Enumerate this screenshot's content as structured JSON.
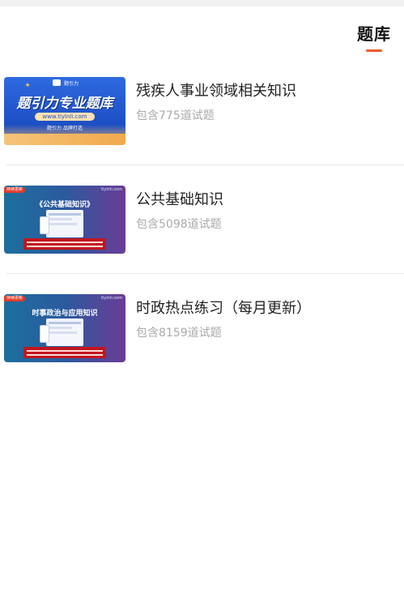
{
  "header": {
    "tab_label": "题库"
  },
  "items": [
    {
      "title": "残疾人事业领域相关知识",
      "subtitle": "包含775道试题",
      "thumb": {
        "headline": "题引力专业题库",
        "url": "www.tiylnli.com",
        "footer": "题引力 品牌打造",
        "logo_text": "题引力"
      }
    },
    {
      "title": "公共基础知识",
      "subtitle": "包含5098道试题",
      "thumb": {
        "tag": "持续更新",
        "site": "tiylnli.com",
        "heading": "《公共基础知识》"
      }
    },
    {
      "title": "时政热点练习（每月更新）",
      "subtitle": "包含8159道试题",
      "thumb": {
        "tag": "持续更新",
        "site": "tiylnli.com",
        "heading": "时事政治与应用知识"
      }
    }
  ],
  "colors": {
    "accent": "#f05a28",
    "title": "#222222",
    "subtitle": "#aaaaaa",
    "thumb_blue": "#1d4fc4",
    "thumb_purple": "#6a3c96"
  }
}
